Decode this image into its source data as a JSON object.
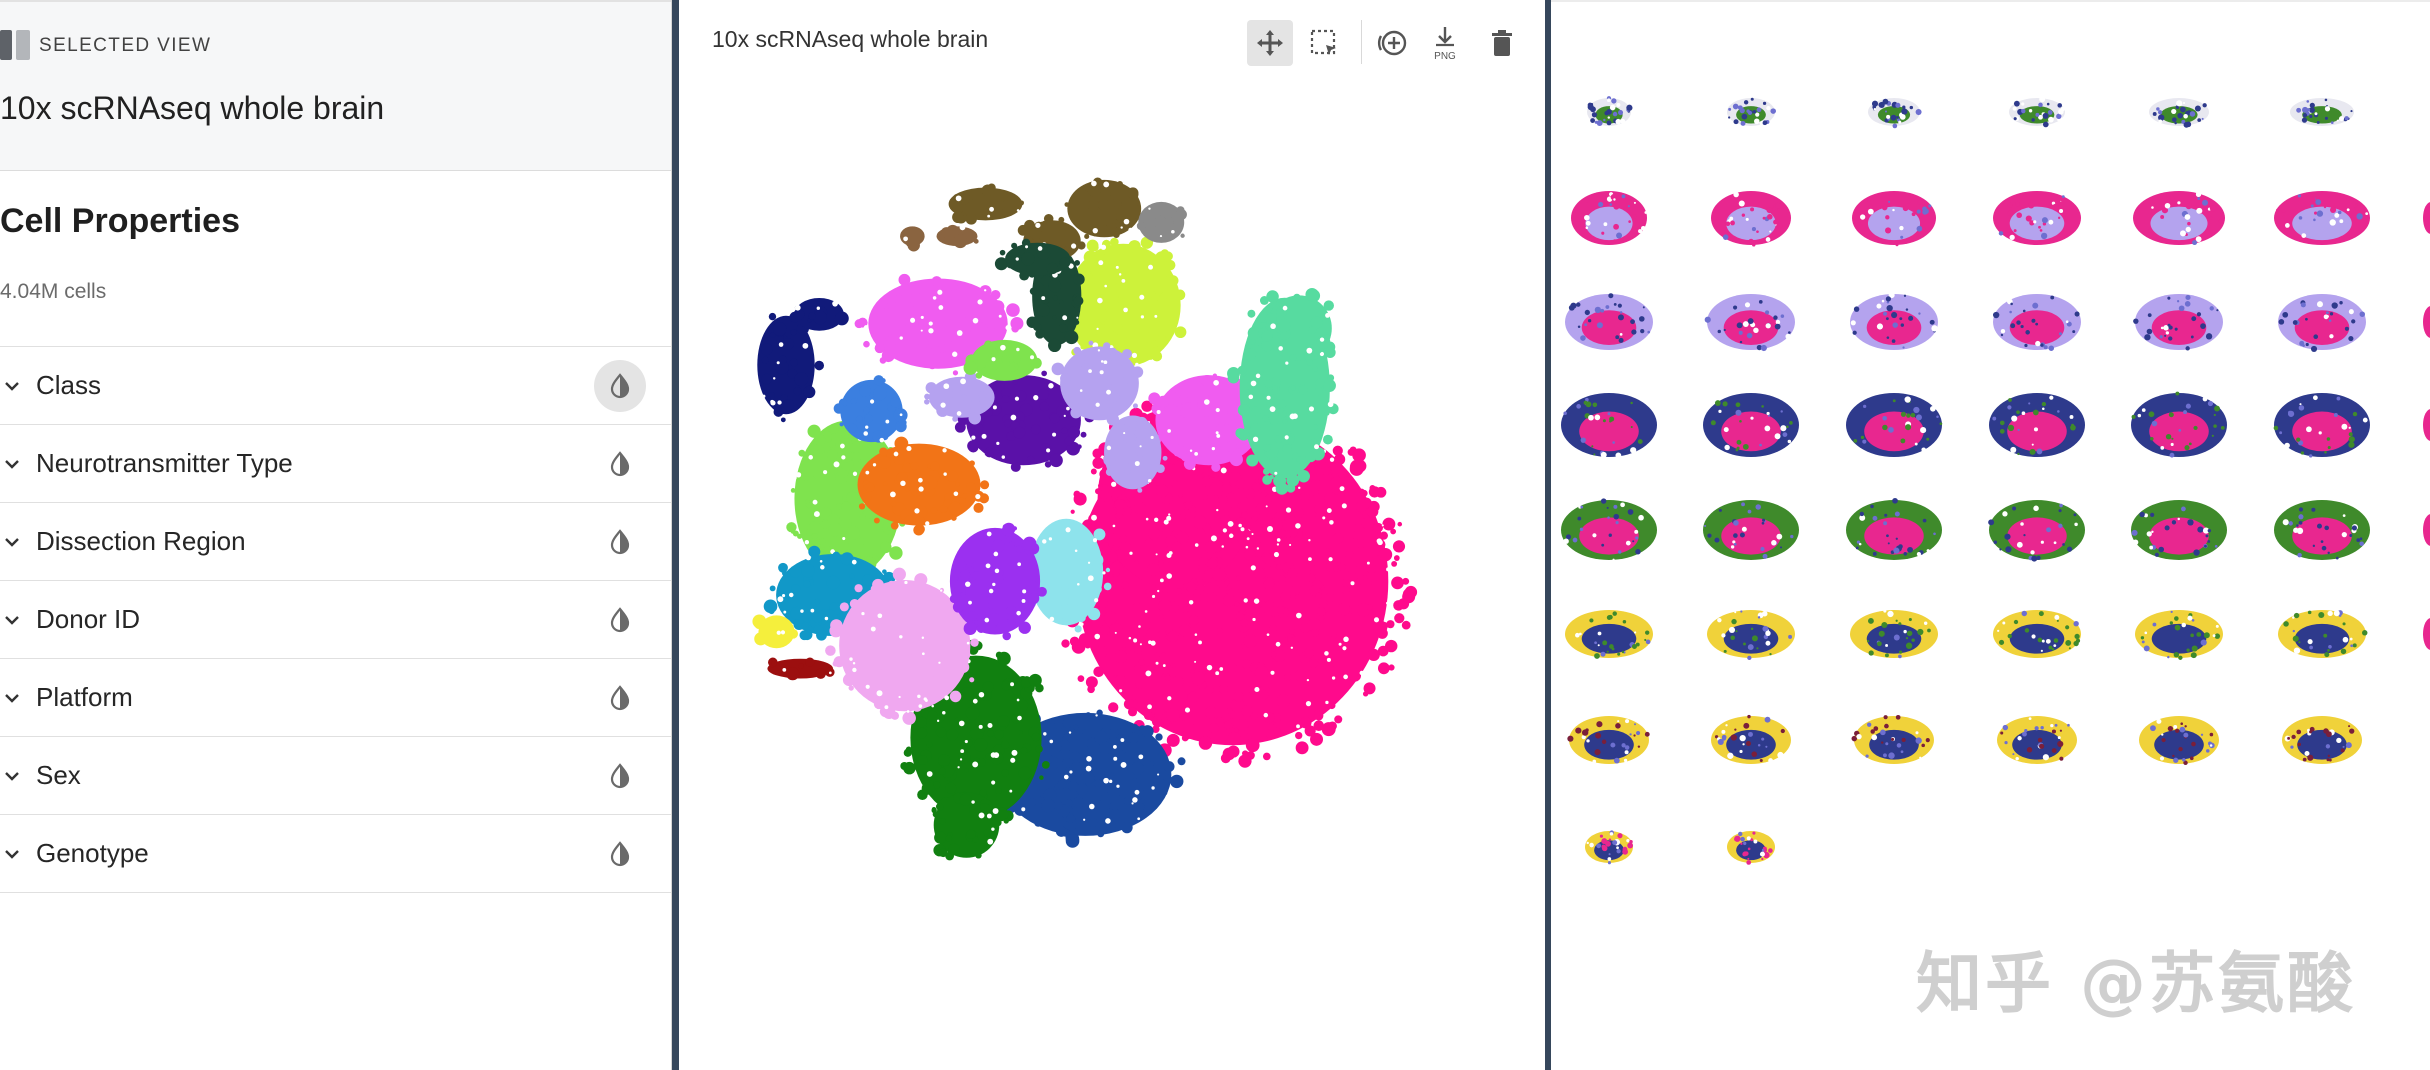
{
  "selected_view": {
    "label": "SELECTED VIEW",
    "title": "10x scRNAseq whole brain",
    "icon": "split-view-icon"
  },
  "cell_properties": {
    "title": "Cell Properties",
    "count": "4.04M cells",
    "items": [
      {
        "label": "Class",
        "icon": "contrast-icon",
        "active": true
      },
      {
        "label": "Neurotransmitter Type",
        "icon": "contrast-icon",
        "active": false
      },
      {
        "label": "Dissection Region",
        "icon": "contrast-icon",
        "active": false
      },
      {
        "label": "Donor ID",
        "icon": "contrast-icon",
        "active": false
      },
      {
        "label": "Platform",
        "icon": "contrast-icon",
        "active": false
      },
      {
        "label": "Sex",
        "icon": "contrast-icon",
        "active": false
      },
      {
        "label": "Genotype",
        "icon": "contrast-icon",
        "active": false
      }
    ]
  },
  "umap_panel": {
    "title": "10x scRNAseq whole brain",
    "toolbar": [
      {
        "name": "pan-icon",
        "active": true
      },
      {
        "name": "box-select-icon",
        "active": false
      },
      {
        "name": "add-view-icon",
        "active": false
      },
      {
        "name": "download-png-icon",
        "label": "PNG",
        "active": false
      },
      {
        "name": "trash-icon",
        "active": false
      }
    ],
    "cluster_colors": [
      "#ff0a8c",
      "#1a4aa0",
      "#118010",
      "#7fe34e",
      "#f27417",
      "#5a11a8",
      "#f05cf0",
      "#57dba0",
      "#cdf23a",
      "#1b4a36",
      "#6e5a26",
      "#1198c8",
      "#111a7a",
      "#3b7fe0",
      "#b5a2f0",
      "#f0a8f0",
      "#8ee3ec",
      "#9b30f0",
      "#9c0f0f",
      "#f5ef3c",
      "#8a6440",
      "#8a8a8a"
    ]
  },
  "slides_panel": {
    "watermark": "知乎 @苏氨酸",
    "slide_palette": [
      "#e8278f",
      "#b4a3ee",
      "#2e3a8c",
      "#e8e8f0",
      "#3f8a2b",
      "#f0d23a",
      "#7a1f3a",
      "#6d6fd0"
    ]
  }
}
